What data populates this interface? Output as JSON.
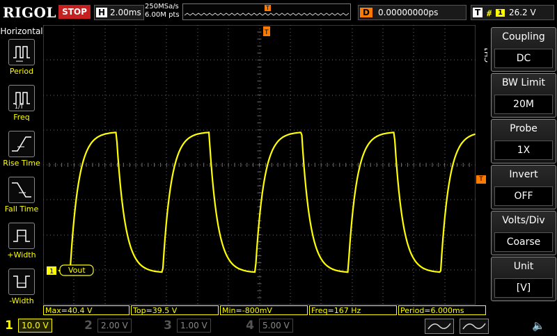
{
  "header": {
    "brand": "RIGOL",
    "run_state": "STOP",
    "horizontal_tag": "H",
    "timebase": "2.00ms",
    "sample_rate": "250MSa/s",
    "memory_depth": "6.00M pts",
    "delay_tag": "D",
    "delay_value": "0.00000000ps",
    "trigger_tag": "T",
    "trigger_edge": "⧣",
    "trigger_source": "1",
    "trigger_level": "26.2 V"
  },
  "left_menu": {
    "title": "Horizontal",
    "items": [
      {
        "label": "Period",
        "icon": "period-icon"
      },
      {
        "label": "Freq",
        "icon": "freq-icon"
      },
      {
        "label": "Rise Time",
        "icon": "rise-time-icon"
      },
      {
        "label": "Fall Time",
        "icon": "fall-time-icon"
      },
      {
        "label": "+Width",
        "icon": "positive-width-icon"
      },
      {
        "label": "-Width",
        "icon": "negative-width-icon"
      }
    ]
  },
  "right_menu": {
    "channel": "CH1",
    "items": [
      {
        "title": "Coupling",
        "value": "DC",
        "arrow": true
      },
      {
        "title": "BW Limit",
        "value": "20M",
        "arrow": false
      },
      {
        "title": "Probe",
        "value": "1X",
        "arrow": true
      },
      {
        "title": "Invert",
        "value": "OFF",
        "arrow": false
      },
      {
        "title": "Volts/Div",
        "value": "Coarse",
        "arrow": false
      },
      {
        "title": "Unit",
        "value": "[V]",
        "arrow": true
      }
    ]
  },
  "screen": {
    "trace_label": "Vout",
    "channel_marker": "1",
    "trigger_marker": "T",
    "colors": {
      "ch1": "#ffff00",
      "ch2": "#00c8ff",
      "ch3": "#ff00ff",
      "ch4": "#1e90ff",
      "trigger": "#ff7a00",
      "grid": "#6b6b6b"
    },
    "waveform": {
      "period_ms": 6.0,
      "high_v": 39.5,
      "low_v": -0.8,
      "timebase_ms_per_div": 2.0,
      "volts_per_div": 10.0
    }
  },
  "measurements": [
    {
      "label": "Max=40.4 V"
    },
    {
      "label": "Top=39.5 V"
    },
    {
      "label": "Min=-800mV"
    },
    {
      "label": "Freq=167 Hz"
    },
    {
      "label": "Period=6.000ms"
    }
  ],
  "channels": [
    {
      "num": "1",
      "scale": "10.0 V",
      "color": "#ffff00",
      "active": true
    },
    {
      "num": "2",
      "scale": "2.00 V",
      "color": "#00c8ff",
      "active": false
    },
    {
      "num": "3",
      "scale": "1.00 V",
      "color": "#ff00ff",
      "active": false
    },
    {
      "num": "4",
      "scale": "5.00 V",
      "color": "#1e90ff",
      "active": false
    }
  ]
}
